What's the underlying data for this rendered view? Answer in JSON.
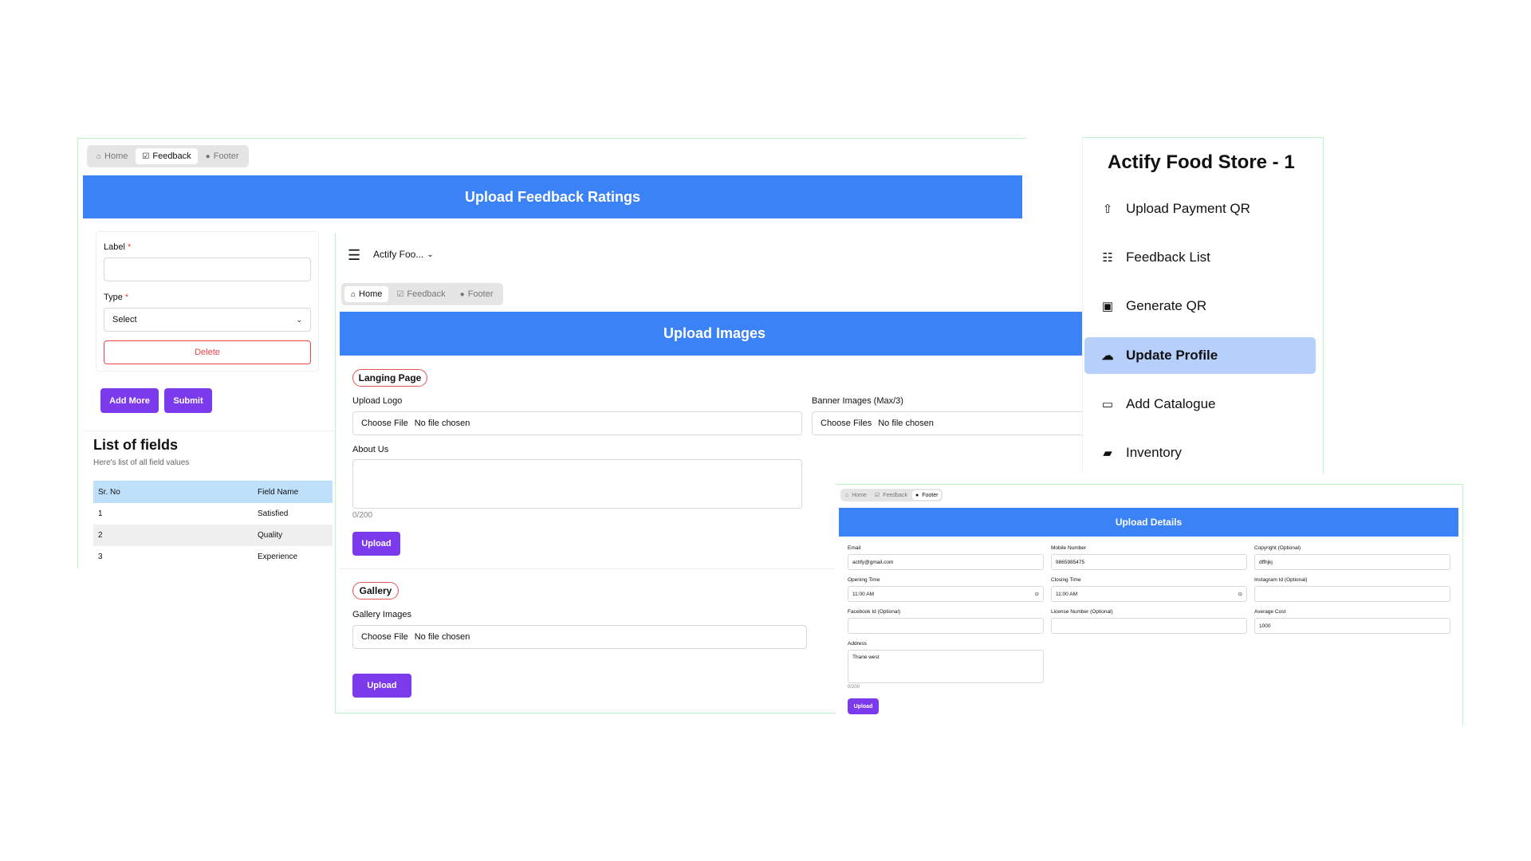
{
  "feedback_panel": {
    "tabs": [
      {
        "label": "Home",
        "icon": "home-icon"
      },
      {
        "label": "Feedback",
        "icon": "feedback-icon"
      },
      {
        "label": "Footer",
        "icon": "footer-icon"
      }
    ],
    "title": "Upload Feedback Ratings",
    "label_field": {
      "label": "Label",
      "required": "*",
      "value": ""
    },
    "type_field": {
      "label": "Type",
      "required": "*",
      "selected": "Select"
    },
    "delete_label": "Delete",
    "add_more_label": "Add More",
    "submit_label": "Submit",
    "list_title": "List of fields",
    "list_subtitle": "Here's list of all field values",
    "table": {
      "headers": [
        "Sr. No",
        "Field Name"
      ],
      "rows": [
        [
          "1",
          "Satisfied"
        ],
        [
          "2",
          "Quality"
        ],
        [
          "3",
          "Experience"
        ]
      ]
    }
  },
  "images_panel": {
    "store_selector": "Actify Foo...",
    "tabs": [
      {
        "label": "Home",
        "icon": "home-icon"
      },
      {
        "label": "Feedback",
        "icon": "feedback-icon"
      },
      {
        "label": "Footer",
        "icon": "footer-icon"
      }
    ],
    "title": "Upload Images",
    "landing_chip": "Langing Page",
    "upload_logo_label": "Upload Logo",
    "choose_file": "Choose File",
    "choose_files": "Choose Files",
    "no_file": "No file chosen",
    "banner_label": "Banner Images (Max/3)",
    "about_label": "About Us",
    "about_counter": "0/200",
    "upload_label": "Upload",
    "gallery_chip": "Gallery",
    "gallery_label": "Gallery Images"
  },
  "sidebar": {
    "title": "Actify Food Store - 1",
    "items": [
      {
        "label": "Upload Payment QR",
        "icon": "upload-icon"
      },
      {
        "label": "Feedback List",
        "icon": "list-icon"
      },
      {
        "label": "Generate QR",
        "icon": "qr-icon"
      },
      {
        "label": "Update Profile",
        "icon": "cloud-upload-icon"
      },
      {
        "label": "Add Catalogue",
        "icon": "card-icon"
      },
      {
        "label": "Inventory",
        "icon": "folder-icon"
      }
    ]
  },
  "details_panel": {
    "tabs": [
      {
        "label": "Home",
        "icon": "home-icon"
      },
      {
        "label": "Feedback",
        "icon": "feedback-icon"
      },
      {
        "label": "Footer",
        "icon": "footer-icon"
      }
    ],
    "title": "Upload Details",
    "fields": {
      "email": {
        "label": "Email",
        "value": "actify@gmail.com"
      },
      "mobile": {
        "label": "Mobile Number",
        "value": "9865985475"
      },
      "copyright": {
        "label": "Copyright (Optional)",
        "value": "dffhjkj"
      },
      "opening": {
        "label": "Opening Time",
        "value": "11:00 AM"
      },
      "closing": {
        "label": "Closing Time",
        "value": "11:00 AM"
      },
      "instagram": {
        "label": "Instagram Id (Optional)",
        "value": ""
      },
      "facebook": {
        "label": "Facebook Id (Optional)",
        "value": ""
      },
      "license": {
        "label": "License Number (Optional)",
        "value": ""
      },
      "avg_cost": {
        "label": "Average Cost",
        "value": "1000"
      },
      "address": {
        "label": "Address",
        "value": "Thane west"
      }
    },
    "address_counter": "0/200",
    "upload_label": "Upload"
  },
  "colors": {
    "accent_blue": "#3b82f6",
    "purple": "#7c3aed",
    "sidebar_active": "#b6cffb"
  }
}
